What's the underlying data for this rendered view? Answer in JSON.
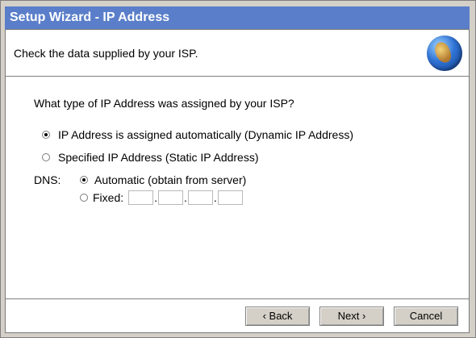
{
  "window": {
    "title": "Setup Wizard - IP Address"
  },
  "header": {
    "text": "Check the data supplied by your ISP.",
    "icon": "globe-icon"
  },
  "question": "What type of IP Address was assigned by your ISP?",
  "options": [
    {
      "label": "IP Address is assigned automatically (Dynamic IP Address)",
      "selected": true
    },
    {
      "label": "Specified IP Address (Static IP Address)",
      "selected": false
    }
  ],
  "dns": {
    "label": "DNS:",
    "automatic_label": "Automatic (obtain from server)",
    "automatic_selected": true,
    "fixed_label": "Fixed:",
    "fixed_selected": false,
    "octets": [
      "",
      "",
      "",
      ""
    ],
    "separator": "."
  },
  "buttons": {
    "back": "‹ Back",
    "next": "Next ›",
    "cancel": "Cancel"
  },
  "colors": {
    "title_bar": "#5a7ec9",
    "dialog_bg": "#d4d0c8",
    "content_bg": "#ffffff"
  }
}
